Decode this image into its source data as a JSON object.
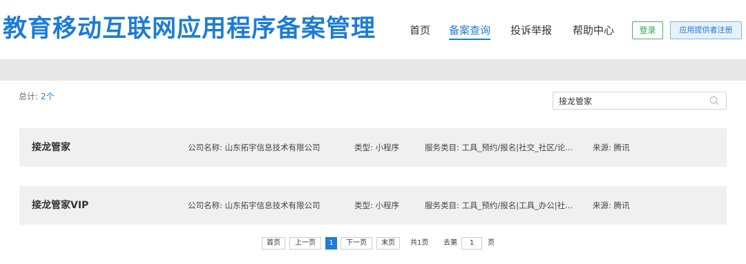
{
  "header": {
    "logo": "教育移动互联网应用程序备案管理",
    "nav": [
      "首页",
      "备案查询",
      "投诉举报",
      "帮助中心"
    ],
    "login": "登录",
    "register": "应用提供者注册"
  },
  "total": {
    "label": "总计: ",
    "count": "2个"
  },
  "search": {
    "value": "接龙管家"
  },
  "results": [
    {
      "name": "接龙管家",
      "company": "公司名称: 山东拓宇信息技术有限公司",
      "type": "类型: 小程序",
      "service": "服务类目: 工具_预约/报名|社交_社区/论...",
      "source": "来源: 腾讯"
    },
    {
      "name": "接龙管家VIP",
      "company": "公司名称: 山东拓宇信息技术有限公司",
      "type": "类型: 小程序",
      "service": "服务类目: 工具_预约/报名|工具_办公|社...",
      "source": "来源: 腾讯"
    }
  ],
  "pager": {
    "first": "首页",
    "prev": "上一页",
    "current": "1",
    "next": "下一页",
    "last": "末页",
    "total_pages": "共1页",
    "goto_label": "去第",
    "goto_value": "1",
    "page_unit": "页"
  },
  "colors": {
    "accent": "#1c7cd6",
    "login_border": "#3cb371",
    "row_bg": "#f0f0f0",
    "band": "#e8e8e8"
  }
}
